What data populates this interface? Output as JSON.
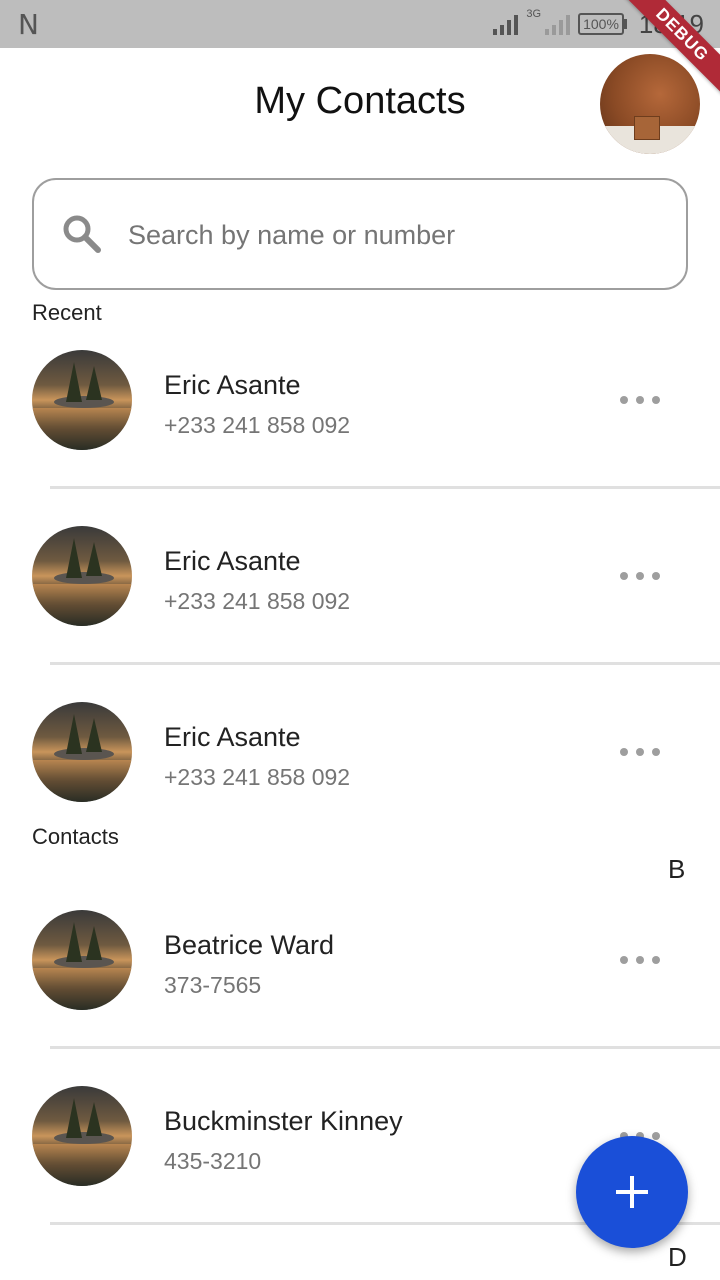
{
  "status_bar": {
    "left_icon": "N",
    "network_type": "3G",
    "battery": "100%",
    "time": "18:19"
  },
  "debug_banner": "DEBUG",
  "header": {
    "title": "My Contacts"
  },
  "search": {
    "placeholder": "Search by name or number",
    "value": ""
  },
  "sections": {
    "recent_label": "Recent",
    "contacts_label": "Contacts",
    "alpha_b": "B",
    "alpha_d": "D"
  },
  "recent": [
    {
      "name": "Eric Asante",
      "phone": "+233 241 858 092"
    },
    {
      "name": "Eric Asante",
      "phone": "+233 241 858 092"
    },
    {
      "name": "Eric Asante",
      "phone": "+233 241 858 092"
    }
  ],
  "contacts": [
    {
      "name": "Beatrice Ward",
      "phone": "373-7565"
    },
    {
      "name": "Buckminster Kinney",
      "phone": "435-3210"
    }
  ],
  "colors": {
    "fab": "#1a4fd8",
    "status_bar": "#bdbdbd",
    "debug_banner": "#b02a37"
  },
  "icons": {
    "search": "search-icon",
    "more": "more-horizontal-icon",
    "add": "plus-icon"
  }
}
